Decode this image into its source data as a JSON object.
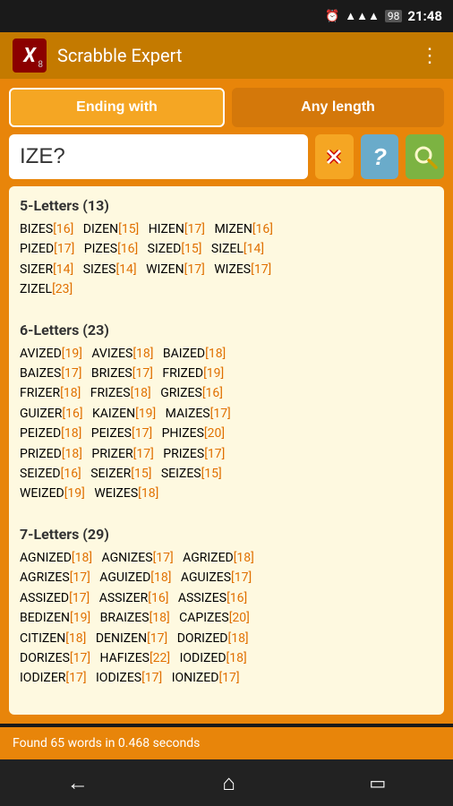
{
  "statusBar": {
    "time": "21:48",
    "batteryIcon": "🔋",
    "batteryLevel": "98",
    "signalIcon": "📶",
    "alarmIcon": "⏰"
  },
  "titleBar": {
    "appIconLetter": "X",
    "appIconSub": "8",
    "appTitle": "Scrabble Expert",
    "menuIcon": "⋮"
  },
  "tabs": {
    "endingWith": "Ending with",
    "anyLength": "Any length"
  },
  "searchInput": {
    "value": "IZE?",
    "placeholder": ""
  },
  "buttons": {
    "clear": "✕",
    "help": "?",
    "search": "🔍"
  },
  "results": {
    "sections": [
      {
        "header": "5-Letters (13)",
        "lines": [
          "BIZES[16]  DIZEN[15]  HIZEN[17]  MIZEN[16]",
          "PIZED[17]  PIZES[16]  SIZED[15]  SIZEL[14]",
          "SIZER[14]  SIZES[14]  WIZEN[17]  WIZES[17]",
          "ZIZEL[23]"
        ]
      },
      {
        "header": "6-Letters (23)",
        "lines": [
          "AVIZED[19]  AVIZES[18]  BAIZED[18]",
          "BAIZES[17]  BRIZES[17]  FRIZED[19]",
          "FRIZER[18]  FRIZES[18]  GRIZES[16]",
          "GUIZER[16]  KAIZEN[19]  MAIZES[17]",
          "PEIZED[18]  PEIZES[17]  PHIZES[20]",
          "PRIZED[18]  PRIZER[17]  PRIZES[17]",
          "SEIZED[16]  SEIZER[15]  SEIZES[15]",
          "WEIZED[19]  WEIZES[18]"
        ]
      },
      {
        "header": "7-Letters (29)",
        "lines": [
          "AGNIZED[18]  AGNIZES[17]  AGRIZED[18]",
          "AGRIZES[17]  AGUIZED[18]  AGUIZES[17]",
          "ASSIZED[17]  ASSIZER[16]  ASSIZES[16]",
          "BEDIZEN[19]  BRAIZES[18]  CAPIZES[20]",
          "CITIZEN[18]  DENIZEN[17]  DORIZED[18]",
          "DORIZES[17]  HAFIZES[22]  IODIZED[18]",
          "IODIZER[17]  IODIZES[17]  IONIZED[17]"
        ]
      }
    ],
    "statusText": "Found 65 words in 0.468 seconds"
  },
  "navBar": {
    "backIcon": "←",
    "homeIcon": "⌂",
    "recentIcon": "▭"
  }
}
